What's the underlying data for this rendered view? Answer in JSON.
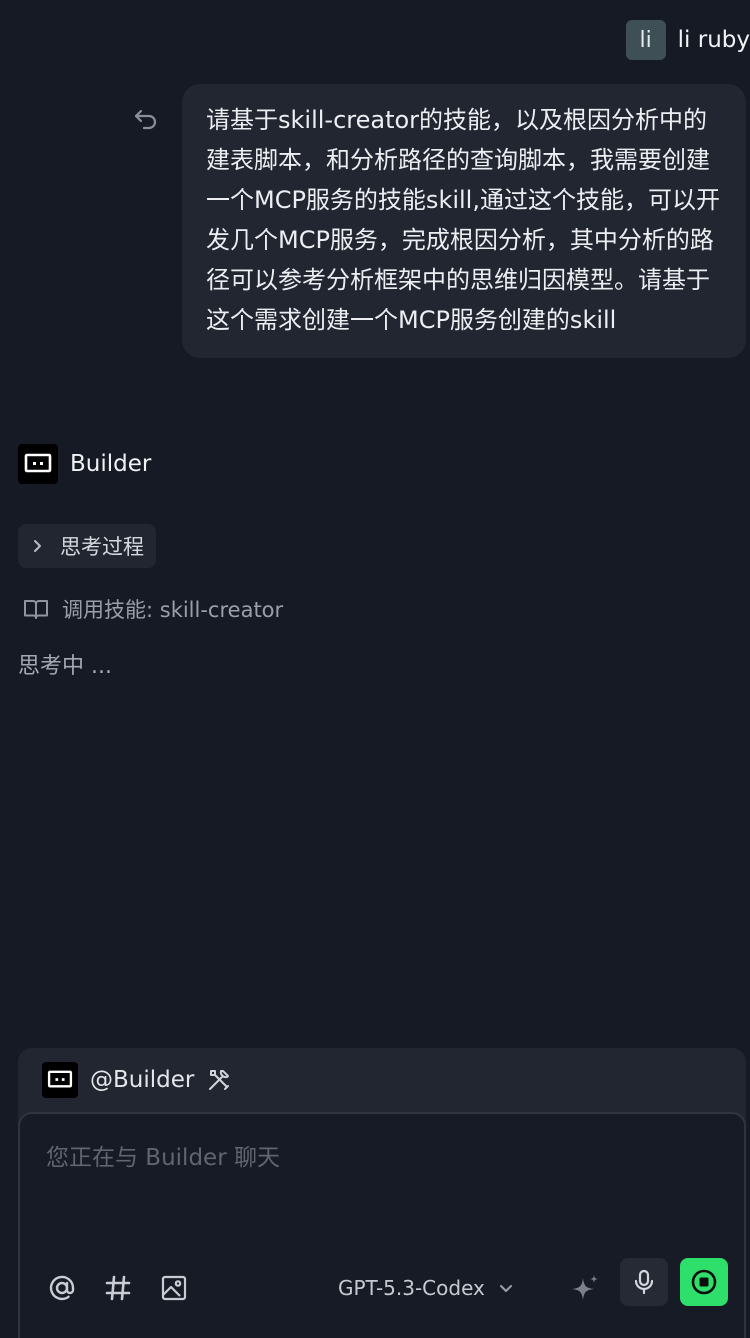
{
  "user": {
    "avatar_initials": "li",
    "name": "li ruby"
  },
  "message": {
    "text": "请基于skill-creator的技能，以及根因分析中的建表脚本，和分析路径的查询脚本，我需要创建一个MCP服务的技能skill,通过这个技能，可以开发几个MCP服务，完成根因分析，其中分析的路径可以参考分析框架中的思维归因模型。请基于这个需求创建一个MCP服务创建的skill"
  },
  "assistant": {
    "name": "Builder",
    "thinking_label": "思考过程",
    "skill_call": "调用技能: skill-creator",
    "status": "思考中 ..."
  },
  "composer": {
    "mention": "@Builder",
    "placeholder": "您正在与 Builder 聊天",
    "value": "",
    "model": "GPT-5.3-Codex"
  },
  "colors": {
    "background": "#161a24",
    "bubble": "#222631",
    "accent_stop": "#2ee06b"
  },
  "icons": {
    "undo": "undo-icon",
    "bot": "builder-logo-icon",
    "thinking": "chevron-right-icon",
    "skill": "book-icon",
    "tools": "tools-icon",
    "at": "at-icon",
    "hash": "hash-icon",
    "image": "image-icon",
    "model": "chevron-down-icon",
    "spark": "sparkle-icon",
    "mic": "microphone-icon",
    "stop": "stop-icon"
  }
}
